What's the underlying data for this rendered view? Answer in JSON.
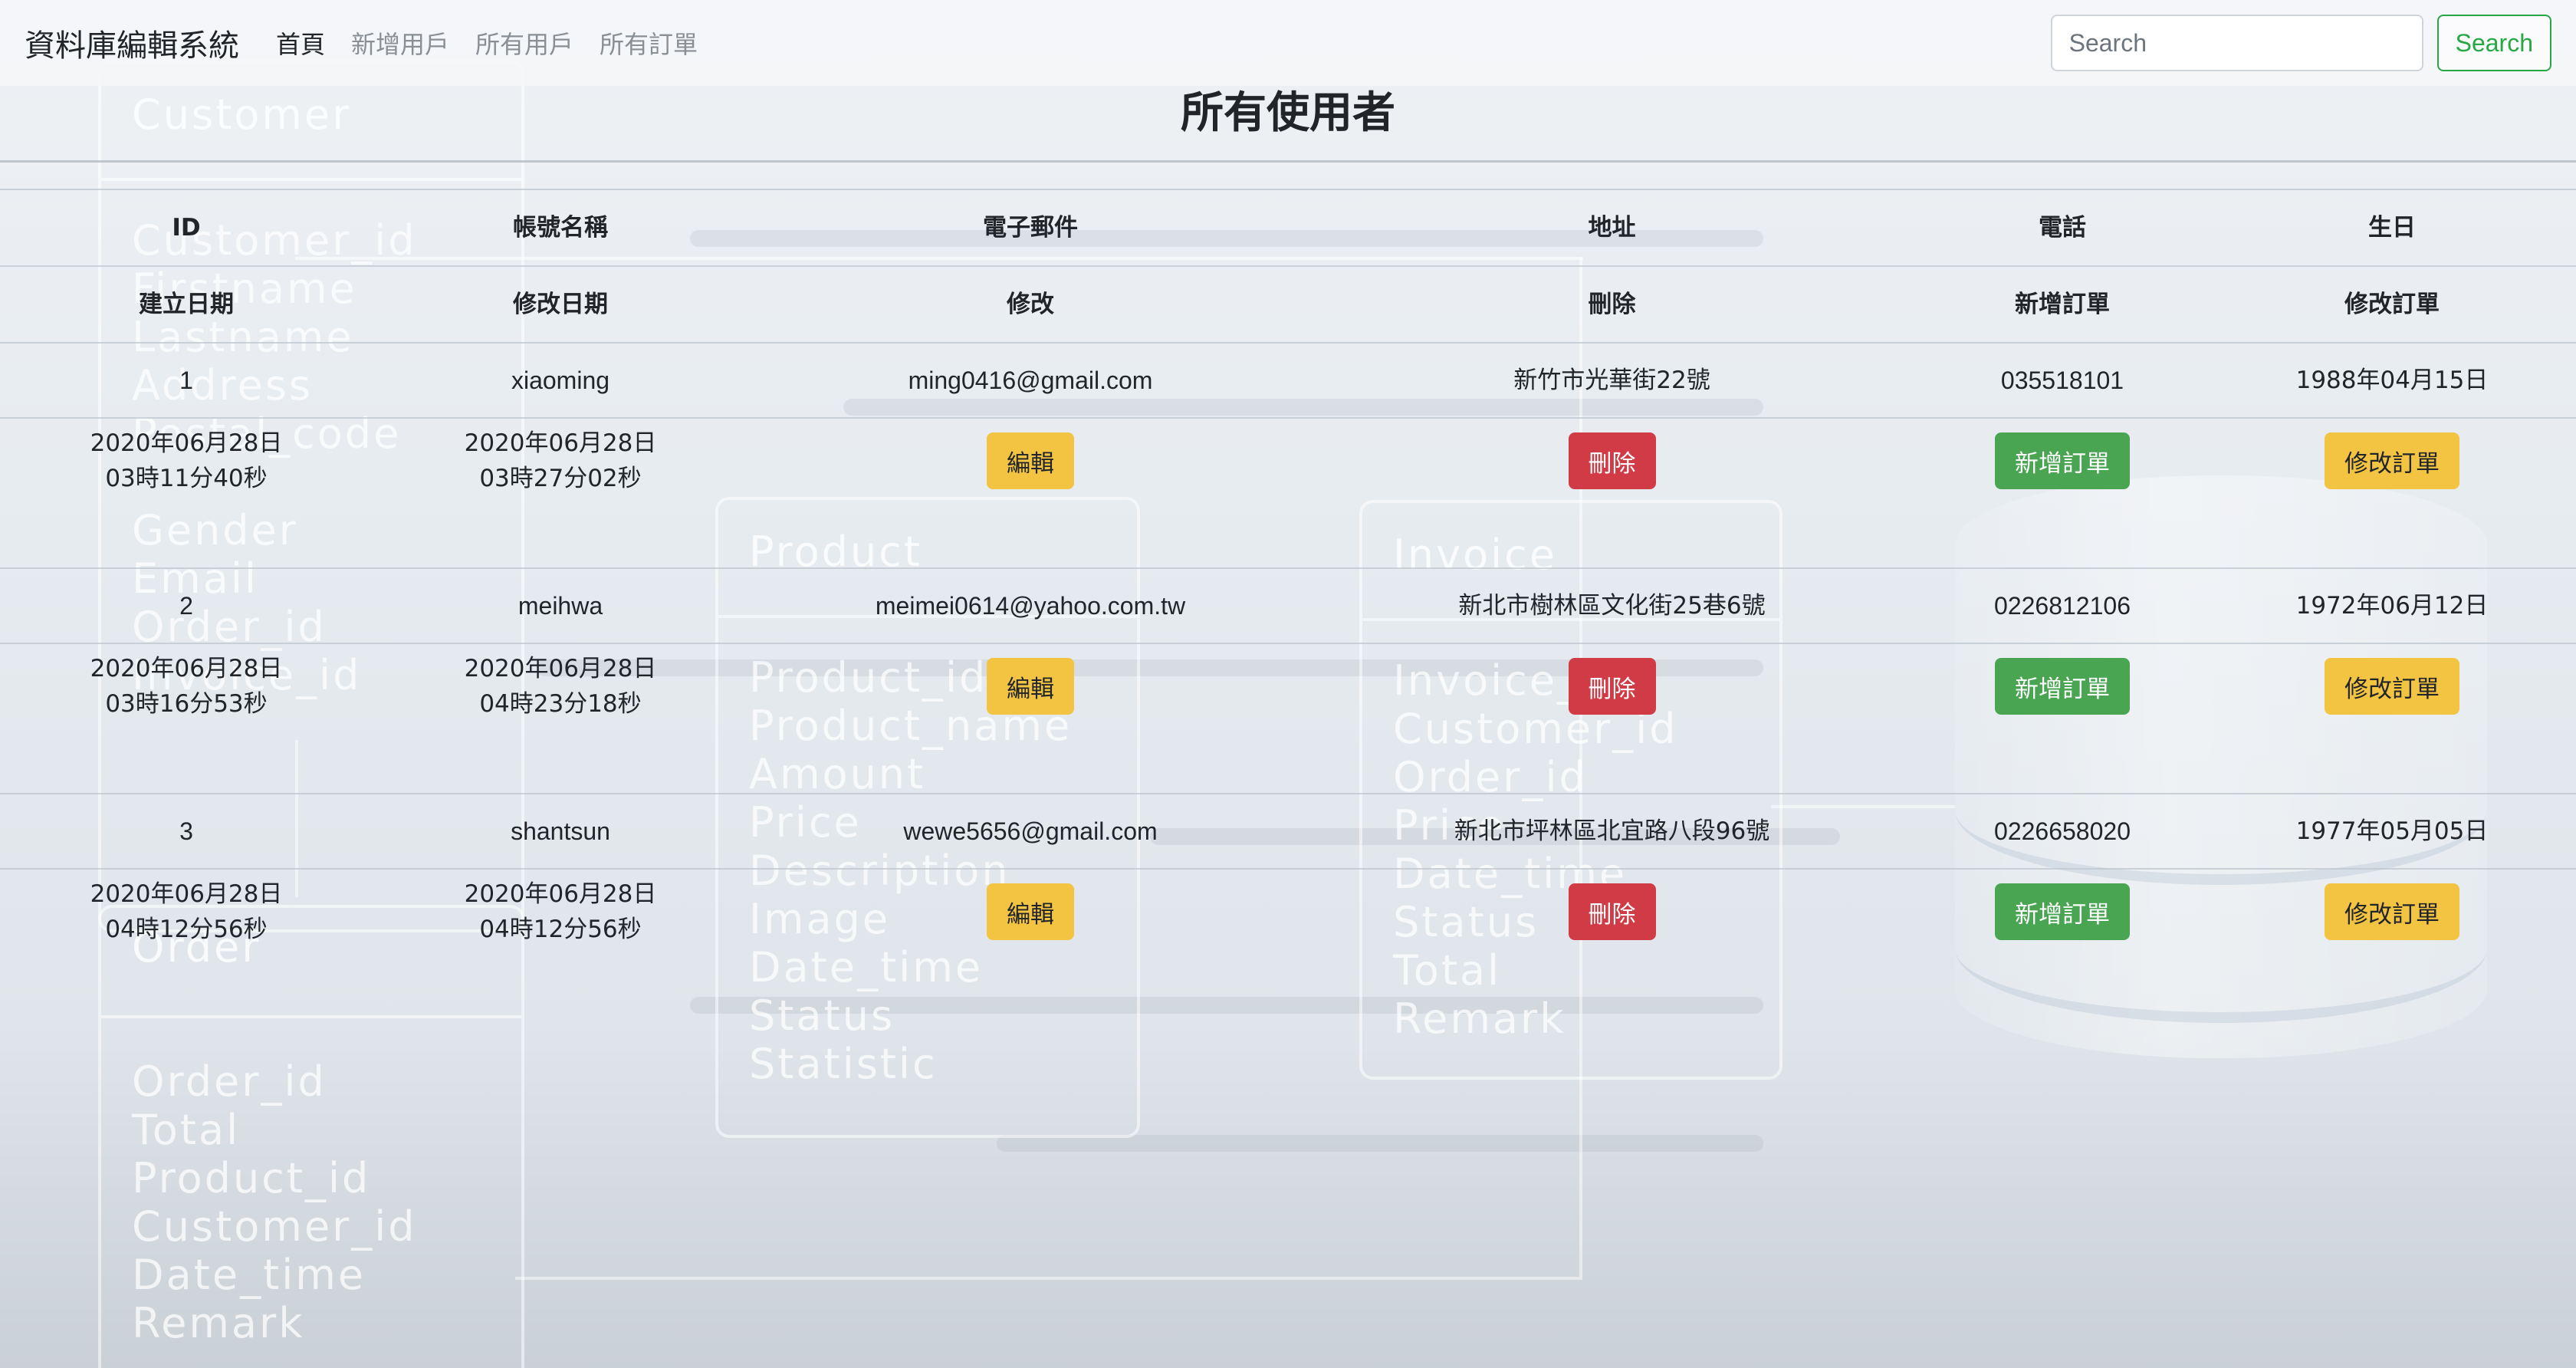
{
  "background": {
    "customer_title": "Customer",
    "customer_fields": [
      "Customer_id",
      "Firstname",
      "Lastname",
      "Address",
      "Postal_code",
      "",
      "Gender",
      "Email",
      "Order_id",
      "Invoice_id"
    ],
    "product_title": "Product",
    "product_fields": [
      "Product_id",
      "Product_name",
      "Amount",
      "Price",
      "Description",
      "Image",
      "Date_time",
      "Status",
      "Statistic"
    ],
    "invoice_title": "Invoice",
    "invoice_fields": [
      "Invoice_id",
      "Customer_id",
      "Order_id",
      "Price",
      "Date_time",
      "Status",
      "Total",
      "Remark"
    ],
    "order_title": "Order",
    "order_fields": [
      "Order_id",
      "Total",
      "Product_id",
      "Customer_id",
      "Date_time",
      "Remark"
    ]
  },
  "navbar": {
    "brand": "資料庫編輯系統",
    "links": [
      "首頁",
      "新增用戶",
      "所有用戶",
      "所有訂單"
    ],
    "search_placeholder": "Search",
    "search_button": "Search"
  },
  "page_title": "所有使用者",
  "table": {
    "header_row1": [
      "ID",
      "帳號名稱",
      "電子郵件",
      "地址",
      "電話",
      "生日"
    ],
    "header_row2": [
      "建立日期",
      "修改日期",
      "修改",
      "刪除",
      "新增訂單",
      "修改訂單"
    ],
    "buttons": {
      "edit": "編輯",
      "delete": "刪除",
      "add_order": "新增訂單",
      "edit_order": "修改訂單"
    },
    "users": [
      {
        "id": "1",
        "username": "xiaoming",
        "email": "ming0416@gmail.com",
        "address": "新竹市光華街22號",
        "phone": "035518101",
        "birthday": "1988年04月15日",
        "created_date": "2020年06月28日",
        "created_time": "03時11分40秒",
        "modified_date": "2020年06月28日",
        "modified_time": "03時27分02秒"
      },
      {
        "id": "2",
        "username": "meihwa",
        "email": "meimei0614@yahoo.com.tw",
        "address": "新北市樹林區文化街25巷6號",
        "phone": "0226812106",
        "birthday": "1972年06月12日",
        "created_date": "2020年06月28日",
        "created_time": "03時16分53秒",
        "modified_date": "2020年06月28日",
        "modified_time": "04時23分18秒"
      },
      {
        "id": "3",
        "username": "shantsun",
        "email": "wewe5656@gmail.com",
        "address": "新北市坪林區北宜路八段96號",
        "phone": "0226658020",
        "birthday": "1977年05月05日",
        "created_date": "2020年06月28日",
        "created_time": "04時12分56秒",
        "modified_date": "2020年06月28日",
        "modified_time": "04時12分56秒"
      }
    ]
  }
}
